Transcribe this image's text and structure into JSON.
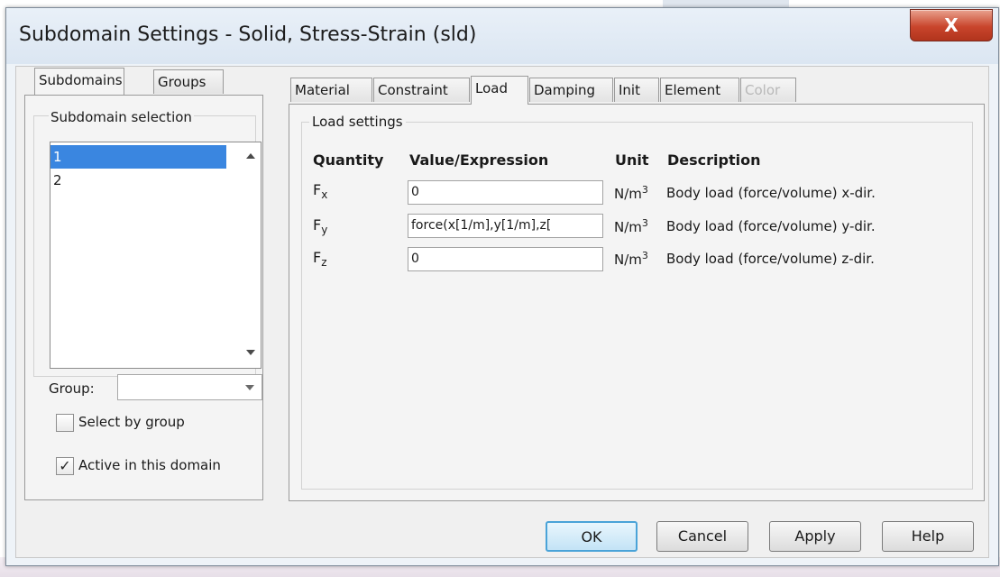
{
  "window": {
    "title": "Subdomain Settings - Solid, Stress-Strain (sld)",
    "close_glyph": "X"
  },
  "left": {
    "tabs": [
      {
        "label": "Subdomains",
        "active": true
      },
      {
        "label": "Groups",
        "active": false
      }
    ],
    "selection_label": "Subdomain selection",
    "subdomains": [
      {
        "label": "1",
        "selected": true
      },
      {
        "label": "2",
        "selected": false
      }
    ],
    "group_label": "Group:",
    "group_value": "",
    "select_by_group": {
      "label": "Select by group",
      "checked": false,
      "mark": ""
    },
    "active_in_domain": {
      "label": "Active in this domain",
      "checked": true,
      "mark": "✓"
    }
  },
  "right": {
    "tabs": [
      {
        "label": "Material",
        "active": false,
        "disabled": false
      },
      {
        "label": "Constraint",
        "active": false,
        "disabled": false
      },
      {
        "label": "Load",
        "active": true,
        "disabled": false
      },
      {
        "label": "Damping",
        "active": false,
        "disabled": false
      },
      {
        "label": "Init",
        "active": false,
        "disabled": false
      },
      {
        "label": "Element",
        "active": false,
        "disabled": false
      },
      {
        "label": "Color",
        "active": false,
        "disabled": true
      }
    ],
    "group_title": "Load settings",
    "headers": {
      "quantity": "Quantity",
      "value": "Value/Expression",
      "unit": "Unit",
      "description": "Description"
    },
    "rows": [
      {
        "symbol": "F",
        "sub": "x",
        "value": "0",
        "unit": "N/m",
        "unit_sup": "3",
        "description": "Body load (force/volume) x-dir."
      },
      {
        "symbol": "F",
        "sub": "y",
        "value": "force(x[1/m],y[1/m],z[",
        "unit": "N/m",
        "unit_sup": "3",
        "description": "Body load (force/volume) y-dir."
      },
      {
        "symbol": "F",
        "sub": "z",
        "value": "0",
        "unit": "N/m",
        "unit_sup": "3",
        "description": "Body load (force/volume) z-dir."
      }
    ]
  },
  "buttons": {
    "ok": "OK",
    "cancel": "Cancel",
    "apply": "Apply",
    "help": "Help"
  },
  "colors": {
    "selection": "#3a86e0",
    "close_button": "#c9452c",
    "default_button_border": "#4aa3d8"
  }
}
